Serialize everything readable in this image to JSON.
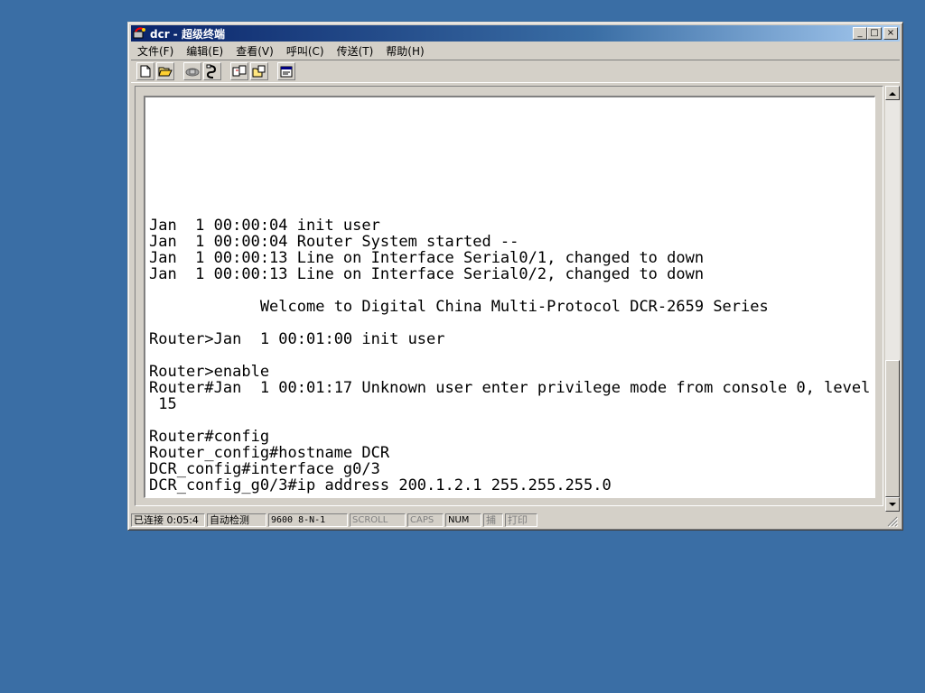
{
  "window": {
    "title": "dcr - 超级终端"
  },
  "title_buttons": {
    "minimize": "_",
    "maximize": "□",
    "close": "×"
  },
  "menu": [
    {
      "label": "文件(F)"
    },
    {
      "label": "编辑(E)"
    },
    {
      "label": "查看(V)"
    },
    {
      "label": "呼叫(C)"
    },
    {
      "label": "传送(T)"
    },
    {
      "label": "帮助(H)"
    }
  ],
  "toolbar": {
    "icons": [
      "new-icon",
      "open-icon",
      "connect-icon",
      "disconnect-icon",
      "send-icon",
      "receive-icon",
      "properties-icon"
    ]
  },
  "terminal": {
    "text": "Jan  1 00:00:04 init user\nJan  1 00:00:04 Router System started --\nJan  1 00:00:13 Line on Interface Serial0/1, changed to down\nJan  1 00:00:13 Line on Interface Serial0/2, changed to down\n\n            Welcome to Digital China Multi-Protocol DCR-2659 Series\n\nRouter>Jan  1 00:01:00 init user\n\nRouter>enable\nRouter#Jan  1 00:01:17 Unknown user enter privilege mode from console 0, level =\n 15\n\nRouter#config\nRouter_config#hostname DCR\nDCR_config#interface g0/3\nDCR_config_g0/3#ip address 200.1.2.1 255.255.255.0"
  },
  "status": {
    "connected": "已连接 0:05:4",
    "detect": "自动检测",
    "baud": "9600 8-N-1",
    "scroll": "SCROLL",
    "caps": "CAPS",
    "num": "NUM",
    "capture": "捕",
    "print": "打印"
  },
  "colors": {
    "desktop": "#3a6ea5",
    "title_start": "#0a246a",
    "chrome": "#d4d0c8"
  }
}
